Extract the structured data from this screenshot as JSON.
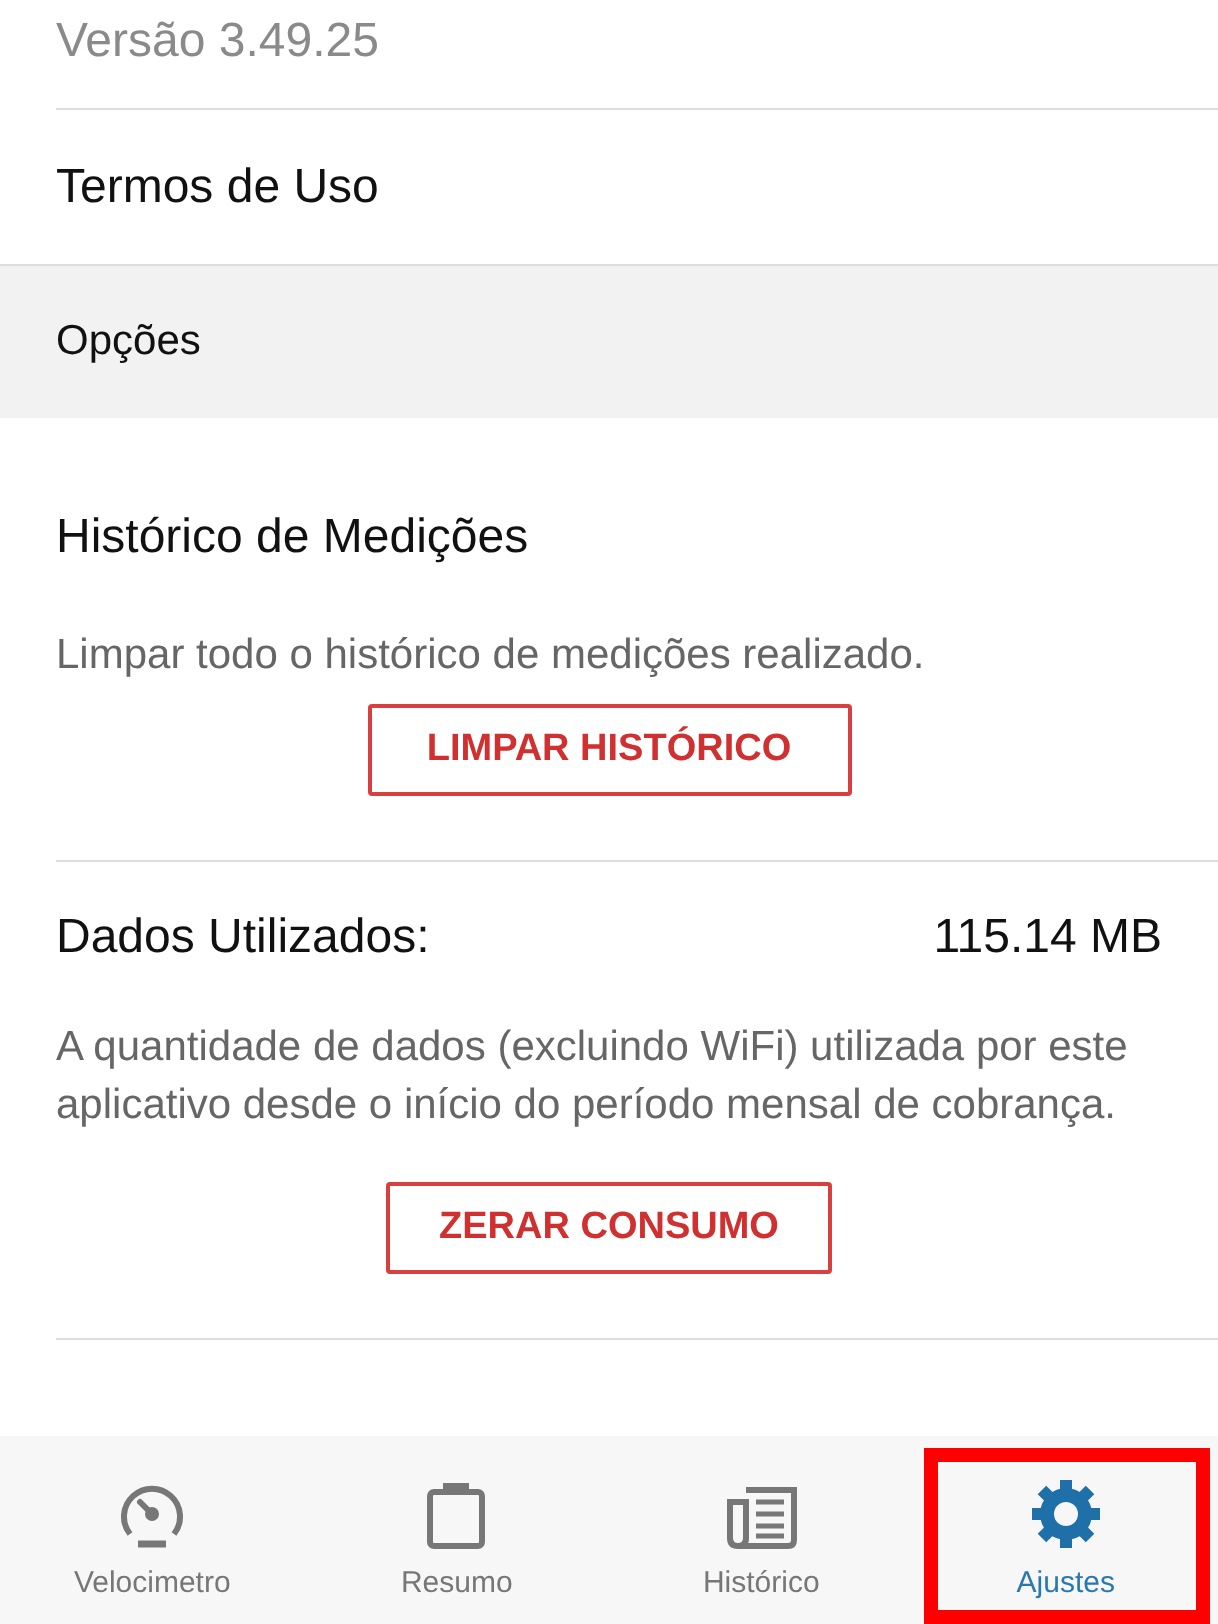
{
  "version": "Versão 3.49.25",
  "terms_link": "Termos de Uso",
  "section_header": "Opções",
  "history_section": {
    "title": "Histórico de Medições",
    "description": "Limpar todo o histórico de medições realizado.",
    "button": "LIMPAR HISTÓRICO"
  },
  "data_section": {
    "title": "Dados Utilizados:",
    "value": "115.14 MB",
    "description": "A quantidade de dados (excluindo WiFi) utilizada por este aplicativo desde o início do período mensal de cobrança.",
    "button": "ZERAR CONSUMO"
  },
  "bottom_nav": [
    {
      "label": "Velocimetro",
      "selected": false,
      "highlighted": false
    },
    {
      "label": "Resumo",
      "selected": false,
      "highlighted": false
    },
    {
      "label": "Histórico",
      "selected": false,
      "highlighted": false
    },
    {
      "label": "Ajustes",
      "selected": true,
      "highlighted": true
    }
  ]
}
